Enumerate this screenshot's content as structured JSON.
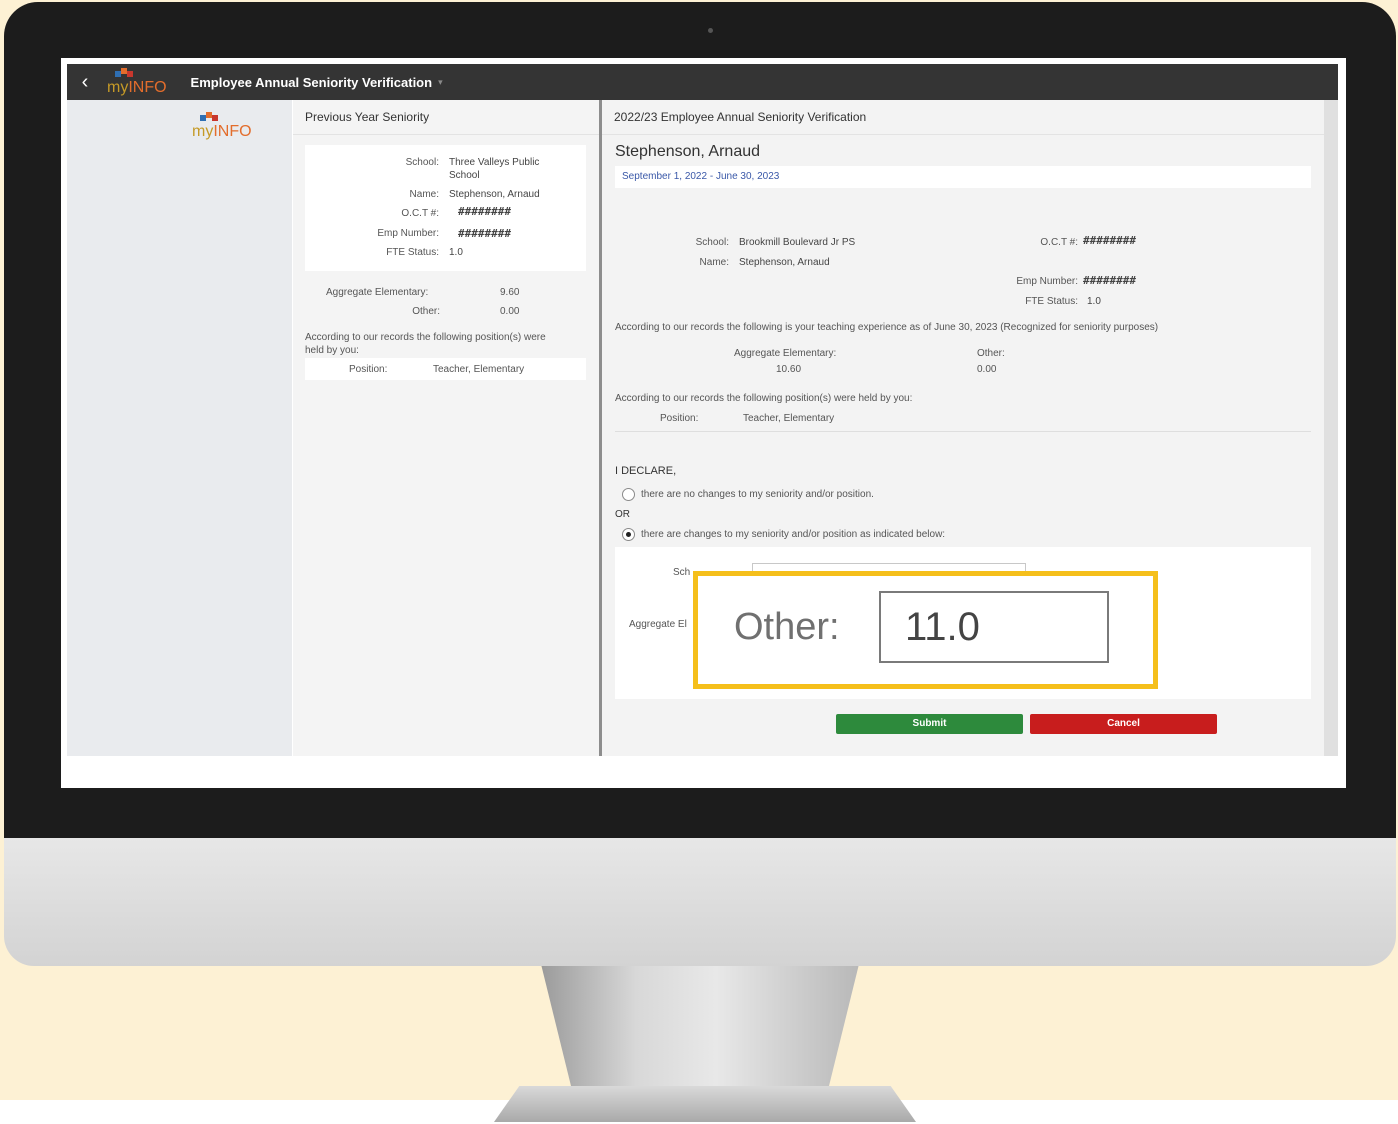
{
  "colors": {
    "background": "#fdf1d4",
    "header": "#343434",
    "accent_link": "#3a58a8",
    "submit": "#2d8a3c",
    "cancel": "#c81d1d",
    "highlight": "#f5bf1b"
  },
  "header": {
    "back_icon": "chevron-left-icon",
    "logo_my": "my",
    "logo_info": "INFO",
    "title": "Employee Annual Seniority Verification",
    "caret": "▾"
  },
  "previous": {
    "title": "Previous Year Seniority",
    "school_label": "School:",
    "school_value_line1": "Three Valleys Public",
    "school_value_line2": "School",
    "name_label": "Name:",
    "name_value": "Stephenson, Arnaud",
    "oct_label": "O.C.T #:",
    "oct_value": "########",
    "emp_label": "Emp Number:",
    "emp_value": "########",
    "fte_label": "FTE Status:",
    "fte_value": "1.0",
    "agg_label": "Aggregate Elementary:",
    "agg_value": "9.60",
    "other_label": "Other:",
    "other_value": "0.00",
    "positions_note_line1": "According to our records the following position(s) were",
    "positions_note_line2": "held by you:",
    "position_label": "Position:",
    "position_value": "Teacher, Elementary"
  },
  "current": {
    "title": "2022/23 Employee Annual Seniority Verification",
    "employee_name": "Stephenson, Arnaud",
    "date_range": "September 1, 2022 - June 30, 2023",
    "school_label": "School:",
    "school_value": "Brookmill Boulevard Jr PS",
    "name_label": "Name:",
    "name_value": "Stephenson, Arnaud",
    "oct_label": "O.C.T #:",
    "oct_value": "########",
    "emp_label": "Emp Number:",
    "emp_value": "########",
    "fte_label": "FTE Status:",
    "fte_value": "1.0",
    "experience_note": "According to our records the following is your teaching experience as of June 30, 2023 (Recognized for seniority purposes)",
    "agg_label": "Aggregate Elementary:",
    "agg_value": "10.60",
    "other_label": "Other:",
    "other_value": "0.00",
    "positions_note": "According to our records the following position(s) were held by you:",
    "position_label": "Position:",
    "position_value": "Teacher, Elementary"
  },
  "declare": {
    "heading": "I DECLARE,",
    "option_no_changes": "there are no changes to my seniority and/or position.",
    "or": "OR",
    "option_changes": "there are changes to my seniority and/or position as indicated below:",
    "selected": "changes"
  },
  "changes_form": {
    "school_label_partial": "Sch",
    "agg_label_partial": "Aggregate El",
    "other_label": "Other:",
    "other_value": "11.0"
  },
  "actions": {
    "submit": "Submit",
    "cancel": "Cancel"
  }
}
